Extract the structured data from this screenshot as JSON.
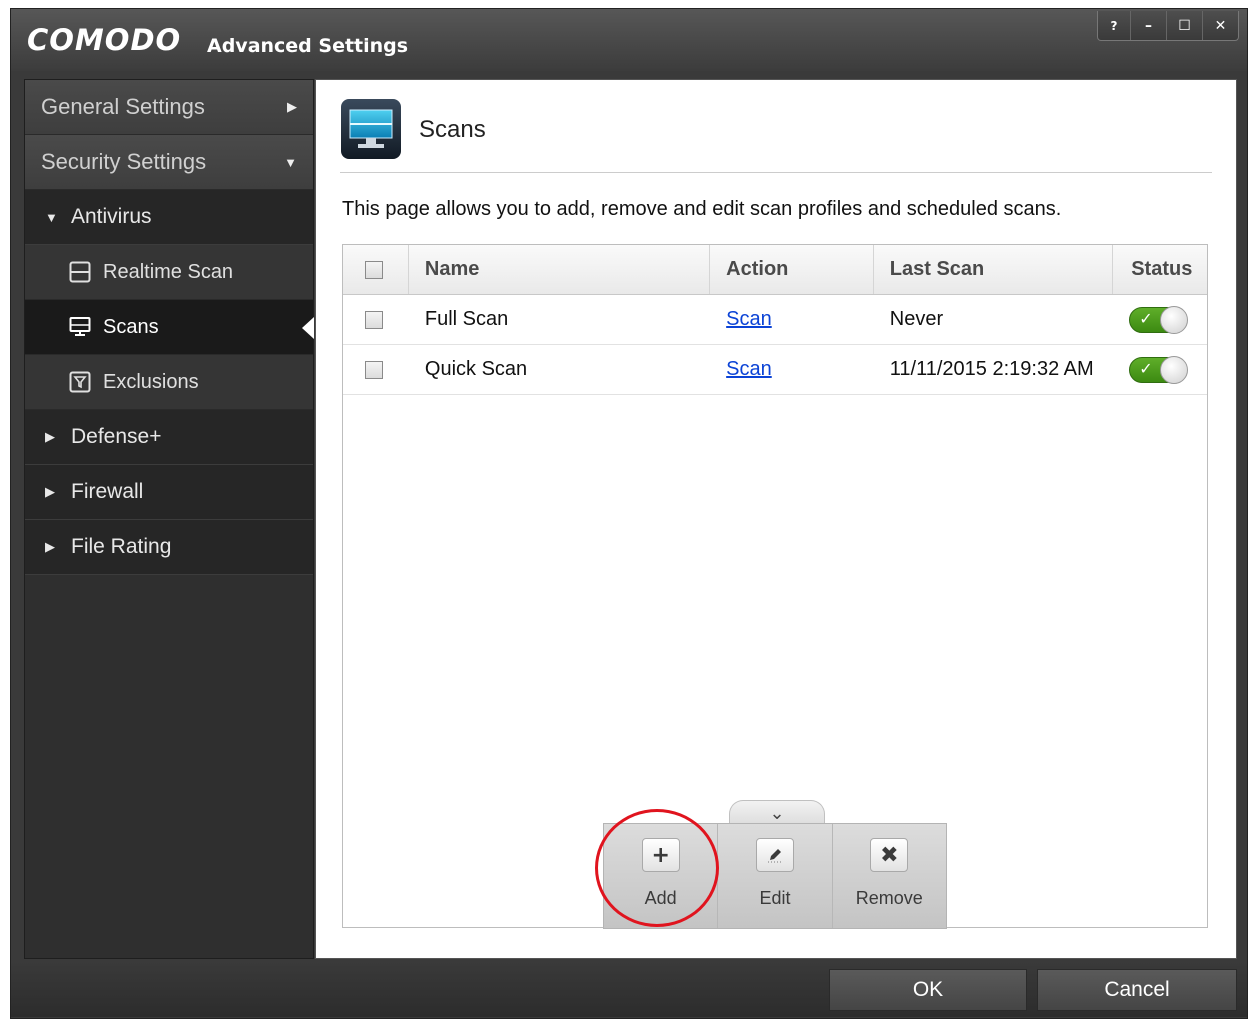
{
  "window": {
    "brand": "COMODO",
    "title": "Advanced Settings",
    "controls": {
      "help": "?",
      "minimize": "–",
      "maximize": "☐",
      "close": "✕"
    }
  },
  "sidebar": {
    "general_settings": "General Settings",
    "security_settings": "Security Settings",
    "antivirus": "Antivirus",
    "items": [
      {
        "label": "Realtime Scan"
      },
      {
        "label": "Scans"
      },
      {
        "label": "Exclusions"
      }
    ],
    "defense": "Defense+",
    "firewall": "Firewall",
    "file_rating": "File Rating"
  },
  "page": {
    "title": "Scans",
    "description": "This page allows you to add, remove and edit scan profiles and scheduled scans."
  },
  "table": {
    "headers": {
      "name": "Name",
      "action": "Action",
      "last_scan": "Last Scan",
      "status": "Status"
    },
    "rows": [
      {
        "name": "Full Scan",
        "action": "Scan",
        "last_scan": "Never",
        "status": "on"
      },
      {
        "name": "Quick Scan",
        "action": "Scan",
        "last_scan": "11/11/2015 2:19:32 AM",
        "status": "on"
      }
    ]
  },
  "toolbar": {
    "add": "Add",
    "edit": "Edit",
    "remove": "Remove",
    "add_icon": "+",
    "remove_icon": "✖",
    "collapse_icon": "⌄"
  },
  "footer": {
    "ok": "OK",
    "cancel": "Cancel"
  },
  "colors": {
    "accent_link": "#0b43d6",
    "toggle_on": "#4f9e1f",
    "highlight": "#e0141e"
  }
}
